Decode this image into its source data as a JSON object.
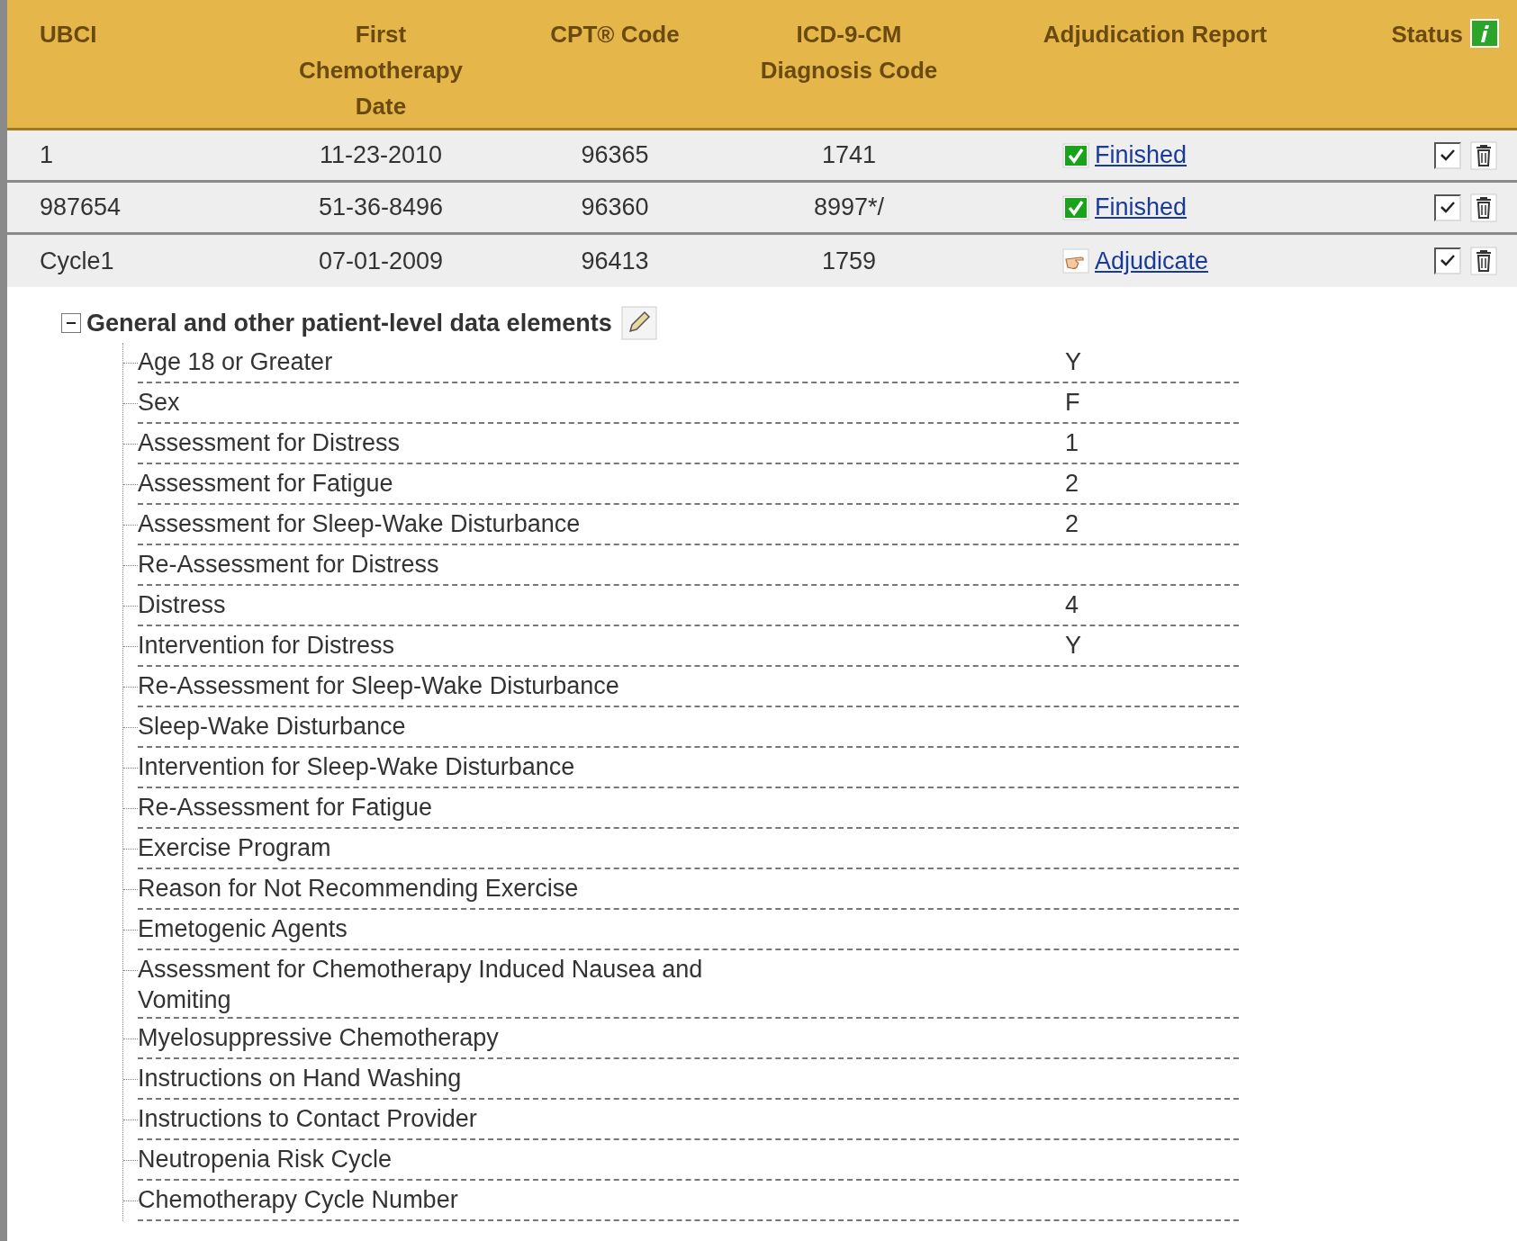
{
  "table": {
    "columns": [
      "UBCI",
      "First Chemotherapy Date",
      "CPT® Code",
      "ICD-9-CM Diagnosis Code",
      "Adjudication Report",
      "Status"
    ],
    "rows": [
      {
        "ubci": "1",
        "date": "11-23-2010",
        "cpt": "96365",
        "icd": "1741",
        "report": {
          "kind": "finished",
          "label": "Finished"
        },
        "checked": true
      },
      {
        "ubci": "987654",
        "date": "51-36-8496",
        "cpt": "96360",
        "icd": "8997*/",
        "report": {
          "kind": "finished",
          "label": "Finished"
        },
        "checked": true
      },
      {
        "ubci": "Cycle1",
        "date": "07-01-2009",
        "cpt": "96413",
        "icd": "1759",
        "report": {
          "kind": "adjudicate",
          "label": "Adjudicate"
        },
        "checked": true
      }
    ]
  },
  "detail": {
    "title": "General and other patient-level data elements",
    "expanded": true,
    "items": [
      {
        "label": "Age 18 or Greater",
        "value": "Y"
      },
      {
        "label": "Sex",
        "value": "F"
      },
      {
        "label": "Assessment for Distress",
        "value": "1"
      },
      {
        "label": "Assessment for Fatigue",
        "value": "2"
      },
      {
        "label": "Assessment for Sleep-Wake Disturbance",
        "value": "2"
      },
      {
        "label": "Re-Assessment for Distress"
      },
      {
        "label": "Distress",
        "value": "4"
      },
      {
        "label": "Intervention for Distress",
        "value": "Y"
      },
      {
        "label": "Re-Assessment for Sleep-Wake Disturbance"
      },
      {
        "label": "Sleep-Wake Disturbance"
      },
      {
        "label": "Intervention for Sleep-Wake Disturbance"
      },
      {
        "label": "Re-Assessment for Fatigue"
      },
      {
        "label": "Exercise Program"
      },
      {
        "label": "Reason for Not Recommending Exercise"
      },
      {
        "label": "Emetogenic Agents"
      },
      {
        "label": "Assessment for Chemotherapy Induced Nausea and Vomiting"
      },
      {
        "label": "Myelosuppressive Chemotherapy"
      },
      {
        "label": "Instructions on Hand Washing"
      },
      {
        "label": "Instructions to Contact Provider"
      },
      {
        "label": "Neutropenia Risk Cycle"
      },
      {
        "label": "Chemotherapy Cycle Number"
      }
    ]
  }
}
